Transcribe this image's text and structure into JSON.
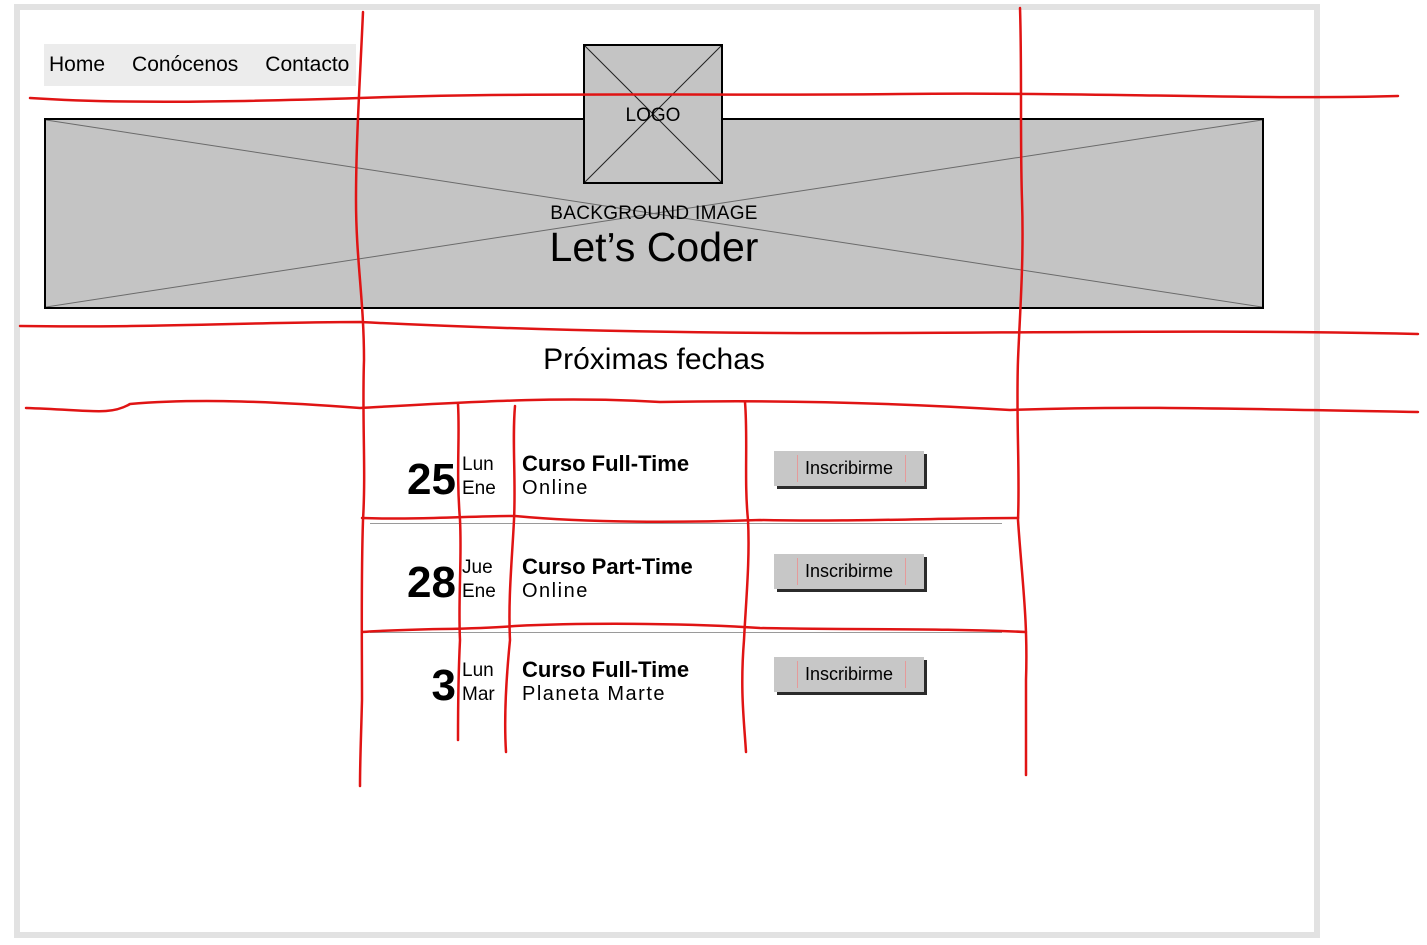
{
  "nav": {
    "items": [
      {
        "label": "Home"
      },
      {
        "label": "Conócenos"
      },
      {
        "label": "Contacto"
      }
    ]
  },
  "logo": {
    "label": "LOGO"
  },
  "hero": {
    "placeholder_label": "BACKGROUND IMAGE",
    "title": "Let’s Coder"
  },
  "events_section": {
    "title": "Próximas fechas",
    "events": [
      {
        "day": "25",
        "weekday": "Lun",
        "month": "Ene",
        "course": "Curso Full-Time",
        "location": "Online",
        "button": "Inscribirme"
      },
      {
        "day": "28",
        "weekday": "Jue",
        "month": "Ene",
        "course": "Curso Part-Time",
        "location": "Online",
        "button": "Inscribirme"
      },
      {
        "day": "3",
        "weekday": "Lun",
        "month": "Mar",
        "course": "Curso Full-Time",
        "location": "Planeta Marte",
        "button": "Inscribirme"
      }
    ]
  },
  "colors": {
    "grid_annotation": "#e01414",
    "placeholder_gray": "#c4c4c4",
    "nav_background": "#ececec"
  }
}
